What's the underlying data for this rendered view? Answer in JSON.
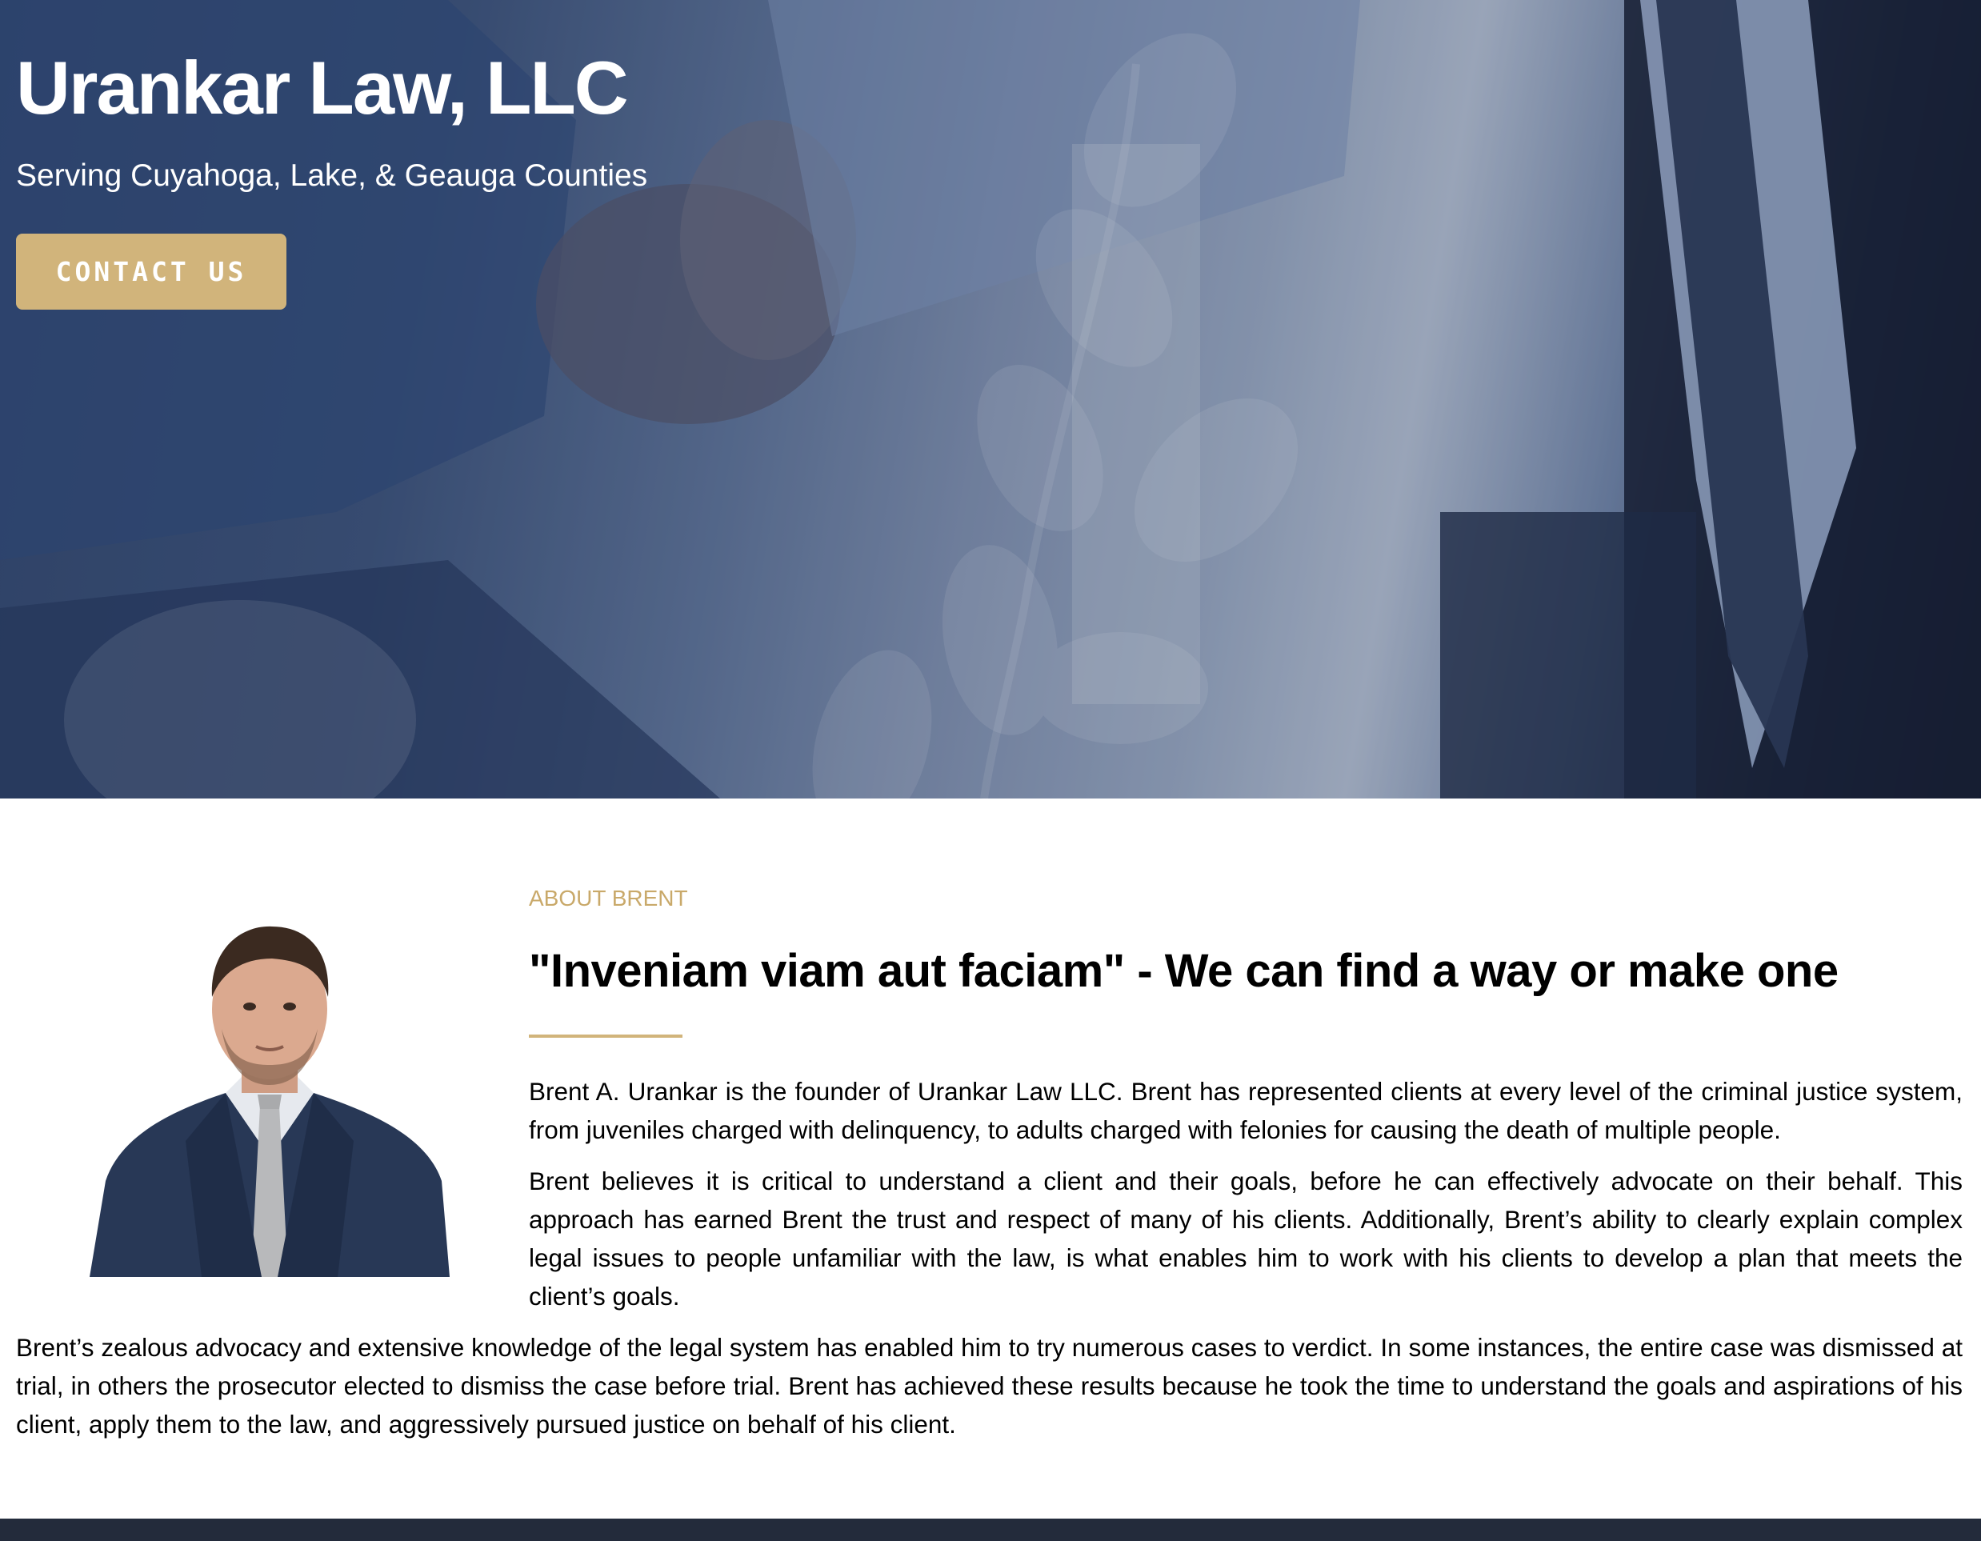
{
  "hero": {
    "title": "Urankar Law, LLC",
    "subtitle": "Serving Cuyahoga, Lake, & Geauga Counties",
    "cta_label": "CONTACT US"
  },
  "about": {
    "label": "ABOUT BRENT",
    "heading": "\"Inveniam viam aut faciam\" - We can find a way or make one",
    "paragraphs": [
      "Brent A. Urankar is the founder of Urankar Law LLC. Brent has represented clients at every level of the criminal justice system, from juveniles charged with delinquency, to adults charged with felonies for causing the death of multiple people.",
      "Brent believes it is critical to understand a client and their goals, before he can effectively advocate on their behalf. This approach has earned Brent the trust and respect of many of his clients. Additionally, Brent’s ability to clearly explain complex legal issues to people unfamiliar with the law, is what enables him to work with his clients to develop a plan that meets the client’s goals.",
      "Brent’s zealous advocacy and extensive knowledge of the legal system has enabled him to try numerous cases to verdict. In some instances, the entire case was dismissed at trial, in others the prosecutor elected to dismiss the case before trial. Brent has achieved these results because he took the time to understand the goals and aspirations of his client, apply them to the law, and aggressively pursued justice on behalf of his client."
    ]
  },
  "colors": {
    "accent": "#d1b47b",
    "label": "#c9a96a",
    "footer": "#232b3b"
  }
}
